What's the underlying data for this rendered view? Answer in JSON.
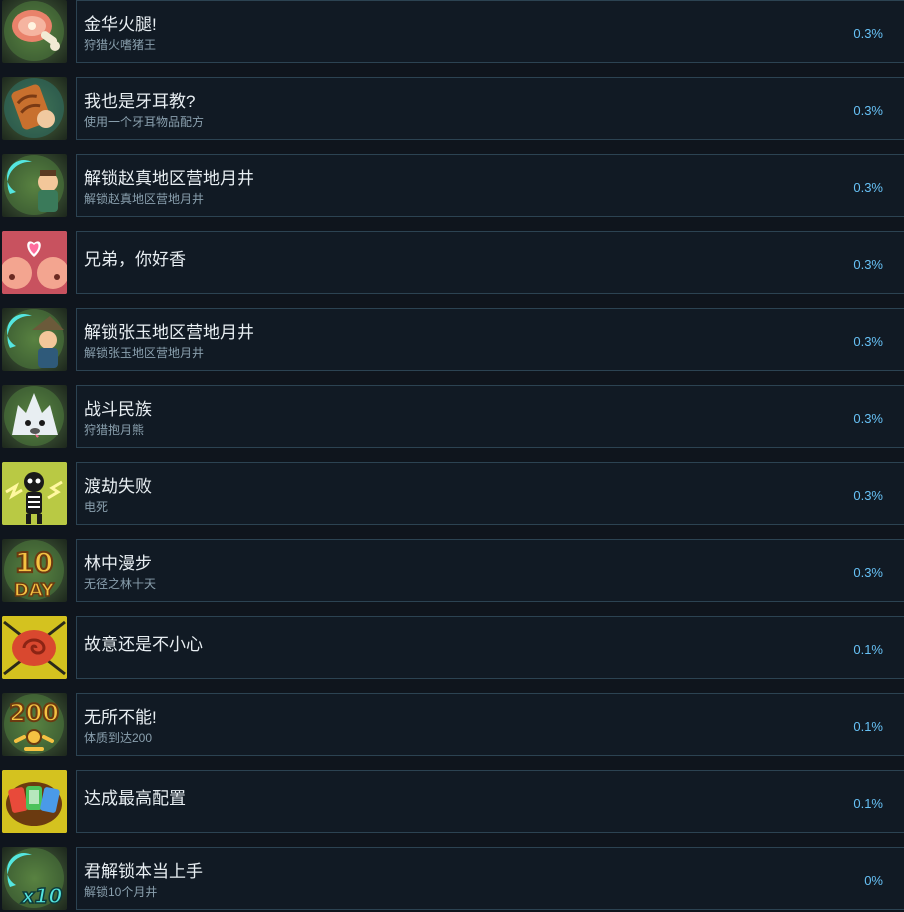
{
  "achievements": [
    {
      "title": "金华火腿!",
      "desc": "狩猎火嗜猪王",
      "percent": "0.3%",
      "icon": "ham-icon",
      "icon_bg": "#3f6b3a"
    },
    {
      "title": "我也是牙耳教?",
      "desc": "使用一个牙耳物品配方",
      "percent": "0.3%",
      "icon": "scroll-icon",
      "icon_bg": "#2f6a5c"
    },
    {
      "title": "解锁赵真地区营地月井",
      "desc": "解锁赵真地区营地月井",
      "percent": "0.3%",
      "icon": "crescent-blade-villager-icon",
      "icon_bg": "#3f6b3a"
    },
    {
      "title": "兄弟，你好香",
      "desc": "",
      "percent": "0.3%",
      "icon": "pig-heart-icon",
      "icon_bg": "#b24a5a"
    },
    {
      "title": "解锁张玉地区营地月井",
      "desc": "解锁张玉地区营地月井",
      "percent": "0.3%",
      "icon": "crescent-blade-hat-icon",
      "icon_bg": "#3f6b3a"
    },
    {
      "title": "战斗民族",
      "desc": "狩猎抱月熊",
      "percent": "0.3%",
      "icon": "white-bear-icon",
      "icon_bg": "#3f6b3a"
    },
    {
      "title": "渡劫失败",
      "desc": "电死",
      "percent": "0.3%",
      "icon": "electrocuted-skeleton-icon",
      "icon_bg": "#a8b83a"
    },
    {
      "title": "林中漫步",
      "desc": "无径之林十天",
      "percent": "0.3%",
      "icon": "ten-day-icon",
      "icon_bg": "#3f6b3a"
    },
    {
      "title": "故意还是不小心",
      "desc": "",
      "percent": "0.1%",
      "icon": "meat-swirl-icon",
      "icon_bg": "#c9b81e"
    },
    {
      "title": "无所不能!",
      "desc": "体质到达200",
      "percent": "0.1%",
      "icon": "two-hundred-icon",
      "icon_bg": "#3f6b3a"
    },
    {
      "title": "达成最高配置",
      "desc": "",
      "percent": "0.1%",
      "icon": "cards-icon",
      "icon_bg": "#c9b81e"
    },
    {
      "title": "君解锁本当上手",
      "desc": "解锁10个月井",
      "percent": "0%",
      "icon": "crescent-blade-x10-icon",
      "icon_bg": "#3f6b3a"
    }
  ],
  "colors": {
    "page_bg": "#0f151d",
    "card_bg": "#111a24",
    "card_border": "#2c4352",
    "title_text": "#e8eef2",
    "desc_text": "#8aa0ae",
    "percent_text": "#67c1f5"
  }
}
